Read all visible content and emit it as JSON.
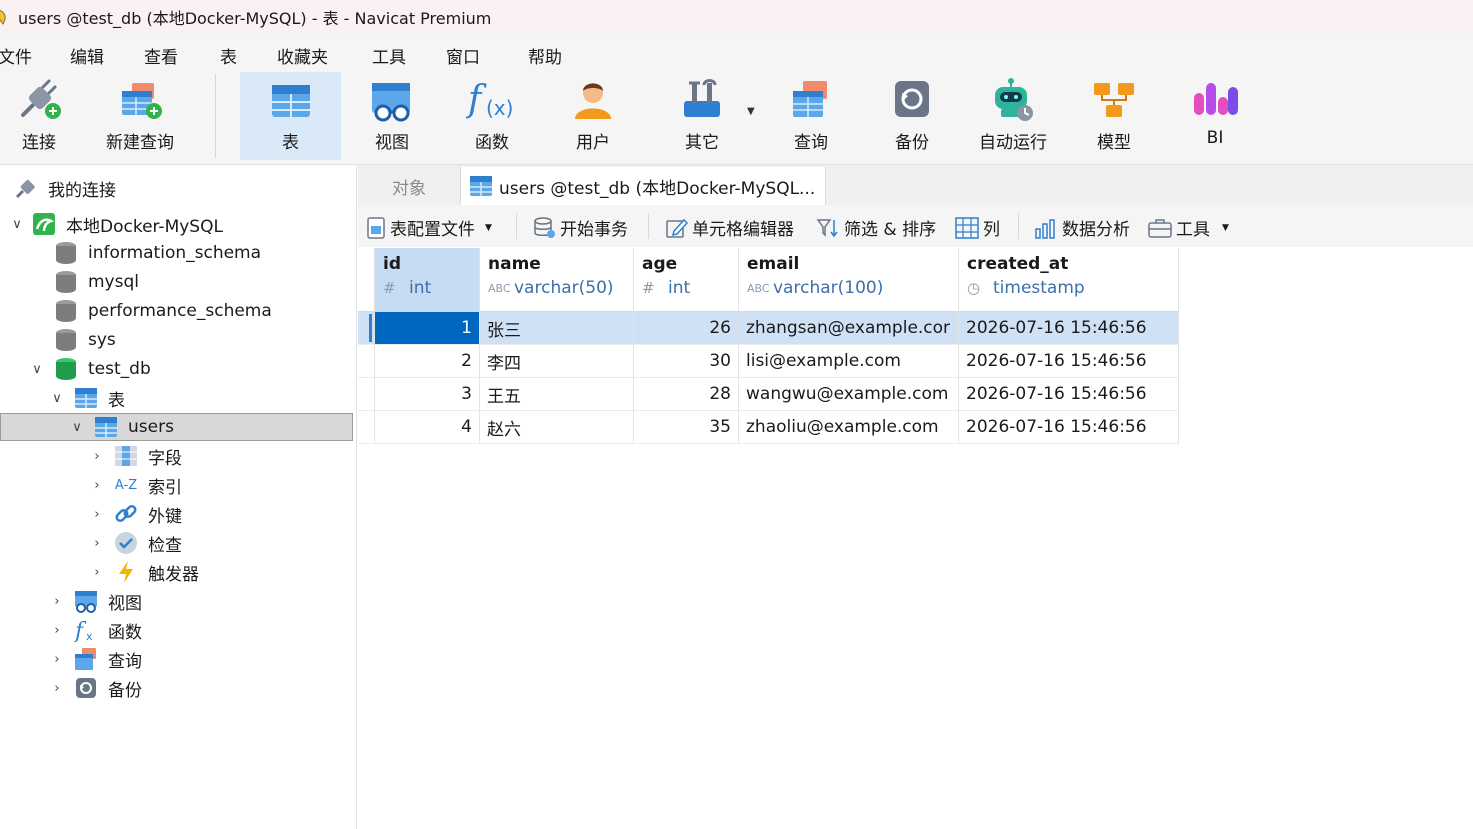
{
  "window": {
    "title": "users @test_db (本地Docker-MySQL) - 表 - Navicat Premium"
  },
  "menu": [
    "文件",
    "编辑",
    "查看",
    "表",
    "收藏夹",
    "工具",
    "窗口",
    "帮助"
  ],
  "toolbar": {
    "items": [
      {
        "label": "连接",
        "icon": "connect-icon"
      },
      {
        "label": "新建查询",
        "icon": "new-query-icon"
      },
      {
        "label": "表",
        "icon": "table-icon",
        "active": true
      },
      {
        "label": "视图",
        "icon": "view-icon"
      },
      {
        "label": "函数",
        "icon": "function-icon"
      },
      {
        "label": "用户",
        "icon": "user-icon"
      },
      {
        "label": "其它",
        "icon": "tools-icon"
      },
      {
        "label": "查询",
        "icon": "query-icon"
      },
      {
        "label": "备份",
        "icon": "backup-icon"
      },
      {
        "label": "自动运行",
        "icon": "robot-icon"
      },
      {
        "label": "模型",
        "icon": "model-icon"
      },
      {
        "label": "BI",
        "icon": "bi-icon"
      }
    ]
  },
  "sidebar": {
    "root": "我的连接",
    "connection": "本地Docker-MySQL",
    "databases": [
      "information_schema",
      "mysql",
      "performance_schema",
      "sys",
      "test_db"
    ],
    "tables_folder": "表",
    "table": "users",
    "table_children": [
      "字段",
      "索引",
      "外键",
      "检查",
      "触发器"
    ],
    "db_folders": [
      "视图",
      "函数",
      "查询",
      "备份"
    ]
  },
  "tabs": {
    "objects": "对象",
    "current": "users @test_db (本地Docker-MySQL..."
  },
  "subtoolbar": {
    "config": "表配置文件",
    "begin_tx": "开始事务",
    "cell_editor": "单元格编辑器",
    "filter_sort": "筛选 & 排序",
    "columns": "列",
    "analyze": "数据分析",
    "tools": "工具"
  },
  "grid": {
    "columns": [
      {
        "name": "id",
        "type": "int",
        "type_icon": "#"
      },
      {
        "name": "name",
        "type": "varchar(50)",
        "type_icon": "ABC"
      },
      {
        "name": "age",
        "type": "int",
        "type_icon": "#"
      },
      {
        "name": "email",
        "type": "varchar(100)",
        "type_icon": "ABC"
      },
      {
        "name": "created_at",
        "type": "timestamp",
        "type_icon": "clock"
      }
    ],
    "rows": [
      [
        "1",
        "张三",
        "26",
        "zhangsan@example.cor",
        "2026-07-16 15:46:56"
      ],
      [
        "2",
        "李四",
        "30",
        "lisi@example.com",
        "2026-07-16 15:46:56"
      ],
      [
        "3",
        "王五",
        "28",
        "wangwu@example.com",
        "2026-07-16 15:46:56"
      ],
      [
        "4",
        "赵六",
        "35",
        "zhaoliu@example.com",
        "2026-07-16 15:46:56"
      ]
    ]
  }
}
